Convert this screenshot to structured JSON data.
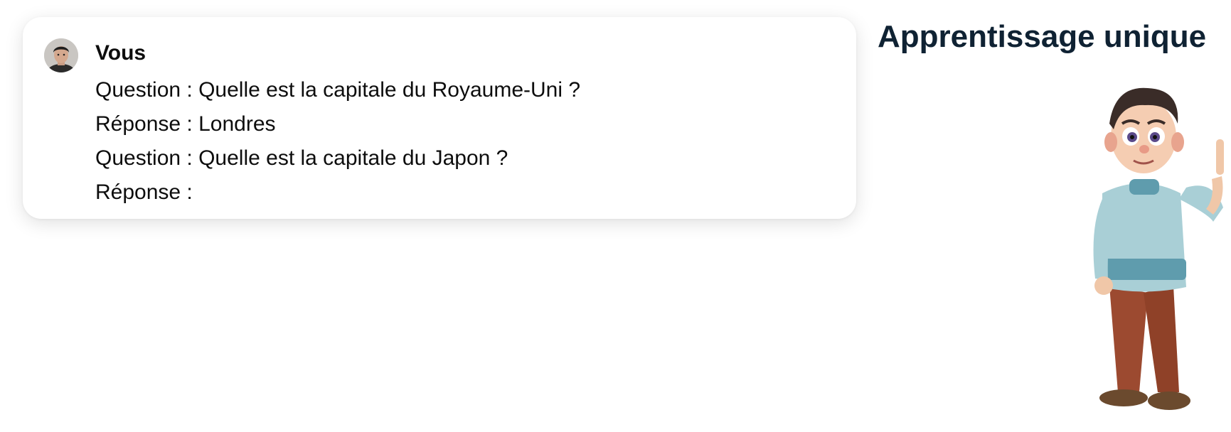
{
  "chat": {
    "sender": "Vous",
    "lines": [
      "Question : Quelle est la capitale du Royaume-Uni ?",
      "Réponse : Londres",
      "Question : Quelle est la capitale du Japon ?",
      "Réponse :"
    ],
    "avatar_icon": "user-avatar-photo"
  },
  "side": {
    "heading": "Apprentissage unique",
    "illustration": "cartoon-boy-raising-index-finger"
  }
}
